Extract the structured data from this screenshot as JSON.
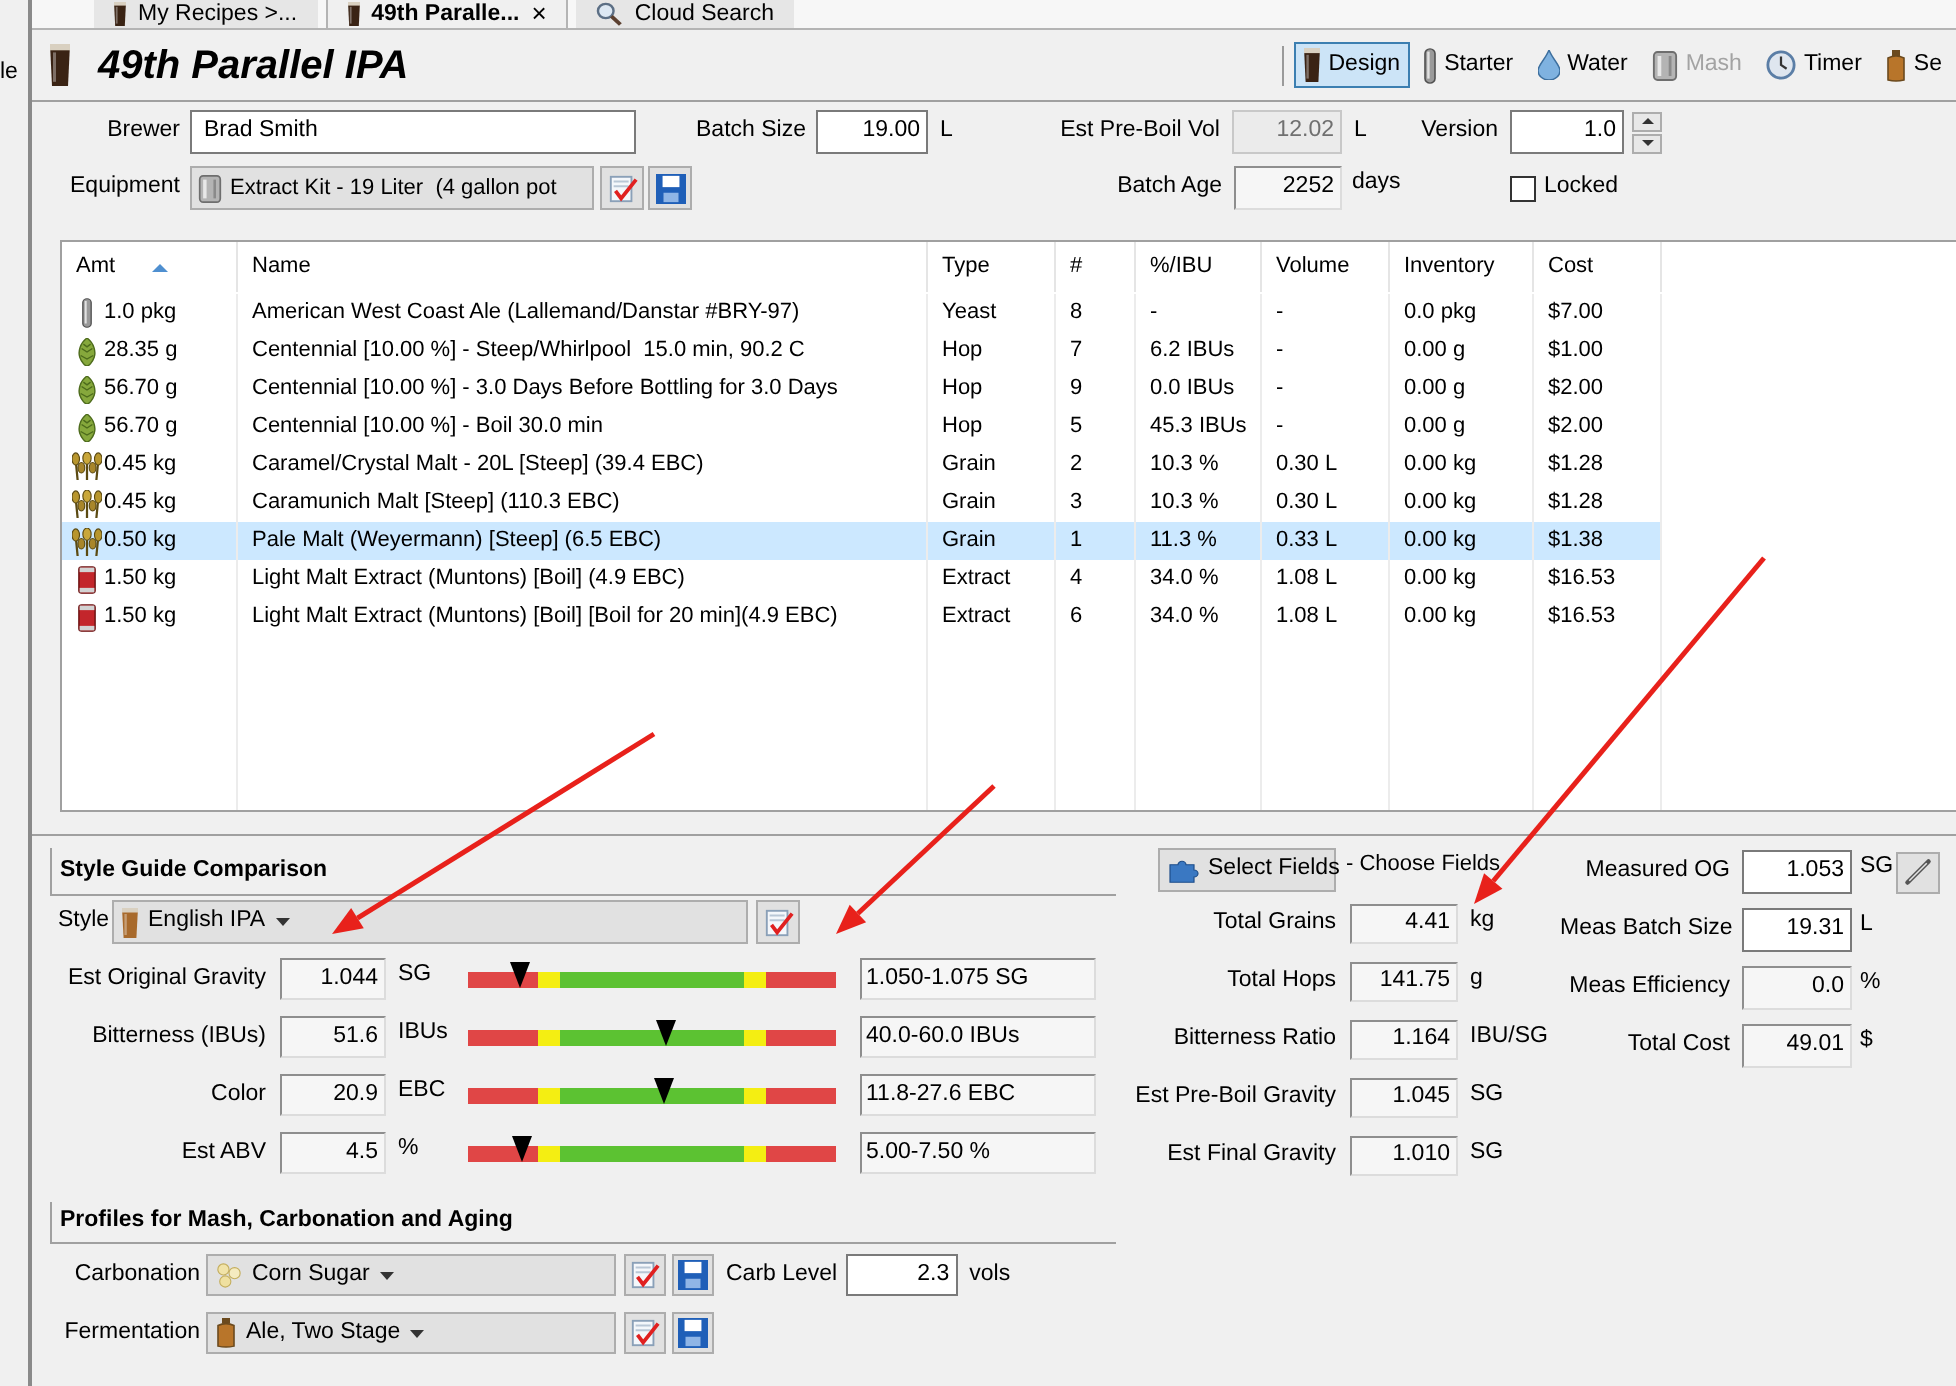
{
  "sidebar": {
    "text": "le"
  },
  "tabs": [
    {
      "label": "My Recipes >...",
      "kind": "list",
      "selected": false
    },
    {
      "label": "49th Paralle...",
      "kind": "recipe",
      "selected": true,
      "close": "×"
    },
    {
      "label": "Cloud Search",
      "kind": "search",
      "selected": false
    }
  ],
  "header": {
    "title": "49th Parallel IPA"
  },
  "toolbar": [
    {
      "label": "Design",
      "kind": "design",
      "selected": true,
      "disabled": false
    },
    {
      "label": "Starter",
      "kind": "starter",
      "selected": false,
      "disabled": false
    },
    {
      "label": "Water",
      "kind": "water",
      "selected": false,
      "disabled": false
    },
    {
      "label": "Mash",
      "kind": "mash",
      "selected": false,
      "disabled": true
    },
    {
      "label": "Timer",
      "kind": "timer",
      "selected": false,
      "disabled": false
    },
    {
      "label": "Se",
      "kind": "bottle",
      "selected": false,
      "disabled": false
    }
  ],
  "form": {
    "brewer": {
      "label": "Brewer",
      "value": "Brad Smith",
      "editable": true
    },
    "batch_size": {
      "label": "Batch Size",
      "value": "19.00",
      "unit": "L",
      "editable": true
    },
    "est_pre_boil_vol": {
      "label": "Est Pre-Boil Vol",
      "value": "12.02",
      "unit": "L",
      "disabled": true
    },
    "version": {
      "label": "Version",
      "value": "1.0",
      "editable": true
    },
    "equipment": {
      "label": "Equipment",
      "value": "Extract Kit - 19 Liter  (4 gallon pot"
    },
    "batch_age": {
      "label": "Batch Age",
      "value": "2252",
      "unit": "days",
      "editable": false
    },
    "locked": {
      "label": "Locked",
      "checked": false
    }
  },
  "ingredients": {
    "columns": [
      {
        "label": "Amt",
        "sorted": true
      },
      {
        "label": "Name",
        "sorted": false
      },
      {
        "label": "Type",
        "sorted": false
      },
      {
        "label": "#",
        "sorted": false
      },
      {
        "label": "%/IBU",
        "sorted": false
      },
      {
        "label": "Volume",
        "sorted": false
      },
      {
        "label": "Inventory",
        "sorted": false
      },
      {
        "label": "Cost",
        "sorted": false
      }
    ],
    "rows": [
      {
        "kind": "yeast",
        "amount": "1.0 pkg",
        "name": "American West Coast Ale (Lallemand/Danstar #BRY-97)",
        "type": "Yeast",
        "number": "8",
        "pct_ibu": "-",
        "volume": "-",
        "inventory": "0.0 pkg",
        "cost": "$7.00",
        "selected": false
      },
      {
        "kind": "hop",
        "amount": "28.35 g",
        "name": "Centennial [10.00 %] - Steep/Whirlpool  15.0 min, 90.2 C",
        "type": "Hop",
        "number": "7",
        "pct_ibu": "6.2 IBUs",
        "volume": "-",
        "inventory": "0.00 g",
        "cost": "$1.00",
        "selected": false
      },
      {
        "kind": "hop",
        "amount": "56.70 g",
        "name": "Centennial [10.00 %] - 3.0 Days Before Bottling for 3.0 Days",
        "type": "Hop",
        "number": "9",
        "pct_ibu": "0.0 IBUs",
        "volume": "-",
        "inventory": "0.00 g",
        "cost": "$2.00",
        "selected": false
      },
      {
        "kind": "hop",
        "amount": "56.70 g",
        "name": "Centennial [10.00 %] - Boil 30.0 min",
        "type": "Hop",
        "number": "5",
        "pct_ibu": "45.3 IBUs",
        "volume": "-",
        "inventory": "0.00 g",
        "cost": "$2.00",
        "selected": false
      },
      {
        "kind": "grain",
        "amount": "0.45 kg",
        "name": "Caramel/Crystal Malt - 20L [Steep] (39.4 EBC)",
        "type": "Grain",
        "number": "2",
        "pct_ibu": "10.3 %",
        "volume": "0.30 L",
        "inventory": "0.00 kg",
        "cost": "$1.28",
        "selected": false
      },
      {
        "kind": "grain",
        "amount": "0.45 kg",
        "name": "Caramunich Malt [Steep] (110.3 EBC)",
        "type": "Grain",
        "number": "3",
        "pct_ibu": "10.3 %",
        "volume": "0.30 L",
        "inventory": "0.00 kg",
        "cost": "$1.28",
        "selected": false
      },
      {
        "kind": "grain",
        "amount": "0.50 kg",
        "name": "Pale Malt (Weyermann) [Steep] (6.5 EBC)",
        "type": "Grain",
        "number": "1",
        "pct_ibu": "11.3 %",
        "volume": "0.33 L",
        "inventory": "0.00 kg",
        "cost": "$1.38",
        "selected": true
      },
      {
        "kind": "extract",
        "amount": "1.50 kg",
        "name": "Light Malt Extract (Muntons) [Boil] (4.9 EBC)",
        "type": "Extract",
        "number": "4",
        "pct_ibu": "34.0 %",
        "volume": "1.08 L",
        "inventory": "0.00 kg",
        "cost": "$16.53",
        "selected": false
      },
      {
        "kind": "extract",
        "amount": "1.50 kg",
        "name": "Light Malt Extract (Muntons) [Boil] [Boil for 20 min](4.9 EBC)",
        "type": "Extract",
        "number": "6",
        "pct_ibu": "34.0 %",
        "volume": "1.08 L",
        "inventory": "0.00 kg",
        "cost": "$16.53",
        "selected": false
      }
    ]
  },
  "style_guide": {
    "title": "Style Guide Comparison",
    "style": {
      "label": "Style",
      "value": "English IPA"
    },
    "rows": [
      {
        "label": "Est Original Gravity",
        "value": "1.044",
        "unit": "SG",
        "level": 0.14,
        "range": "1.050-1.075 SG"
      },
      {
        "label": "Bitterness (IBUs)",
        "value": "51.6",
        "unit": "IBUs",
        "level": 0.54,
        "range": "40.0-60.0 IBUs"
      },
      {
        "label": "Color",
        "value": "20.9",
        "unit": "EBC",
        "level": 0.534,
        "range": "11.8-27.6 EBC"
      },
      {
        "label": "Est ABV",
        "value": "4.5",
        "unit": "%",
        "level": 0.146,
        "range": "5.00-7.50 %"
      }
    ]
  },
  "profiles": {
    "title": "Profiles for Mash, Carbonation and Aging",
    "carbonation": {
      "label": "Carbonation",
      "value": "Corn Sugar"
    },
    "carb_level": {
      "label": "Carb Level",
      "value": "2.3",
      "unit": "vols"
    },
    "fermentation": {
      "label": "Fermentation",
      "value": "Ale, Two Stage"
    }
  },
  "stats": {
    "button": "Select Fields",
    "hint": "- Choose Fields",
    "rows": [
      {
        "label": "Total Grains",
        "value": "4.41",
        "unit": "kg"
      },
      {
        "label": "Total Hops",
        "value": "141.75",
        "unit": "g"
      },
      {
        "label": "Bitterness Ratio",
        "value": "1.164",
        "unit": "IBU/SG"
      },
      {
        "label": "Est Pre-Boil Gravity",
        "value": "1.045",
        "unit": "SG"
      },
      {
        "label": "Est Final Gravity",
        "value": "1.010",
        "unit": "SG"
      }
    ]
  },
  "measurements": [
    {
      "label": "Measured OG",
      "value": "1.053",
      "unit": "SG",
      "editable": true,
      "tool": true
    },
    {
      "label": "Meas Batch Size",
      "value": "19.31",
      "unit": "L",
      "editable": true,
      "tool": false
    },
    {
      "label": "Meas Efficiency",
      "value": "0.0",
      "unit": "%",
      "editable": false,
      "tool": false
    },
    {
      "label": "Total Cost",
      "value": "49.01",
      "unit": "$",
      "editable": false,
      "tool": false
    }
  ]
}
